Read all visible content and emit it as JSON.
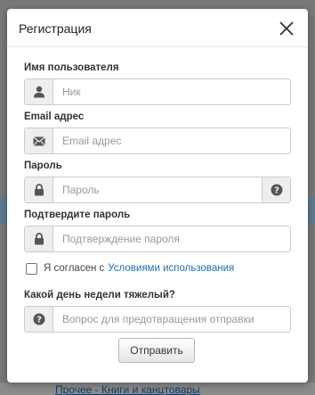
{
  "modal": {
    "title": "Регистрация",
    "submit_label": "Отправить"
  },
  "fields": {
    "username": {
      "label": "Имя пользователя",
      "placeholder": "Ник",
      "icon": "user-icon"
    },
    "email": {
      "label": "Email адрес",
      "placeholder": "Email адрес",
      "icon": "envelope-icon"
    },
    "password": {
      "label": "Пароль",
      "placeholder": "Пароль",
      "icon": "lock-icon",
      "help_icon": "question-circle-icon"
    },
    "confirm": {
      "label": "Подтвердите пароль",
      "placeholder": "Подтверждение пароля",
      "icon": "lock-icon"
    },
    "security": {
      "label": "Какой день недели тяжелый?",
      "placeholder": "Вопрос для предотвращения отправки",
      "icon": "question-circle-icon"
    }
  },
  "terms": {
    "text": "Я согласен с",
    "link": "Условиями использования",
    "checked": false
  },
  "background": {
    "bottom_link": "Прочее - Книги и канцтовары"
  },
  "colors": {
    "link": "#1f6fb2",
    "addon": "#eeeeee",
    "border": "#cccccc"
  }
}
